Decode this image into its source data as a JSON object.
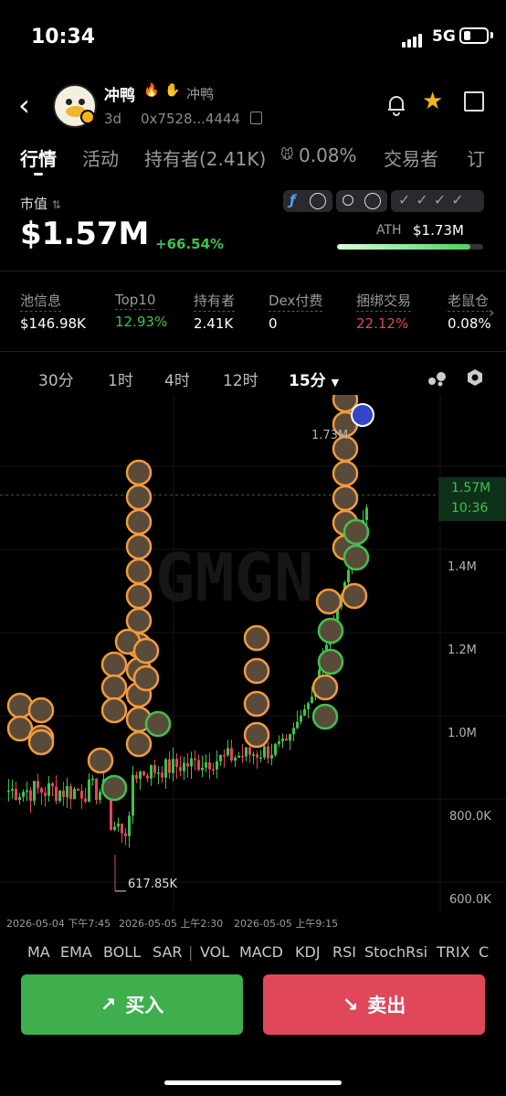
{
  "status_bar": {
    "time": "10:34",
    "network": "5G"
  },
  "token": {
    "name": "冲鸭",
    "alias": "冲鸭",
    "age": "3d",
    "address": "0x7528...4444"
  },
  "tabs": [
    "行情",
    "活动",
    "持有者(2.41K)",
    "0.08%",
    "交易者",
    "订"
  ],
  "market_cap": {
    "label": "市值",
    "value": "$1.57M",
    "change": "+66.54%",
    "ath_label": "ATH",
    "ath_value": "$1.73M",
    "ath_progress": 0.91
  },
  "stats": [
    {
      "label": "池信息",
      "value": "$146.98K",
      "color": "#ffffff"
    },
    {
      "label": "Top10",
      "value": "12.93%",
      "color": "#3ec24f"
    },
    {
      "label": "持有者",
      "value": "2.41K",
      "color": "#ffffff"
    },
    {
      "label": "Dex付费",
      "value": "0",
      "color": "#ffffff"
    },
    {
      "label": "捆绑交易",
      "value": "22.12%",
      "color": "#e0475b"
    },
    {
      "label": "老鼠仓",
      "value": "0.08%",
      "color": "#ffffff"
    }
  ],
  "intervals": [
    "30分",
    "1时",
    "4时",
    "12时",
    "15分"
  ],
  "chart": {
    "watermark": "GMGN",
    "y_ticks": [
      "1.4M",
      "1.2M",
      "1.0M",
      "800.0K",
      "600.0K"
    ],
    "current_price": "1.57M",
    "current_time": "10:36",
    "high_marker": "1.73M",
    "low_marker": "617.85K",
    "x_ticks": [
      "2026-05-04 下午7:45",
      "2026-05-05 上午2:30",
      "2026-05-05 上午9:15"
    ]
  },
  "chart_data": {
    "type": "candlestick",
    "y_unit": "USD market cap",
    "ylim": [
      600000,
      1800000
    ],
    "y_ticks": [
      600000,
      800000,
      1000000,
      1200000,
      1400000
    ],
    "current": 1570000,
    "high": 1730000,
    "low": 617850
  },
  "indicators": [
    "MA",
    "EMA",
    "BOLL",
    "SAR",
    "VOL",
    "MACD",
    "KDJ",
    "RSI",
    "StochRsi",
    "TRIX",
    "C"
  ],
  "actions": {
    "buy": "买入",
    "sell": "卖出"
  },
  "colors": {
    "up": "#3ec24f",
    "down": "#e0475b",
    "accent": "#f3b519"
  }
}
